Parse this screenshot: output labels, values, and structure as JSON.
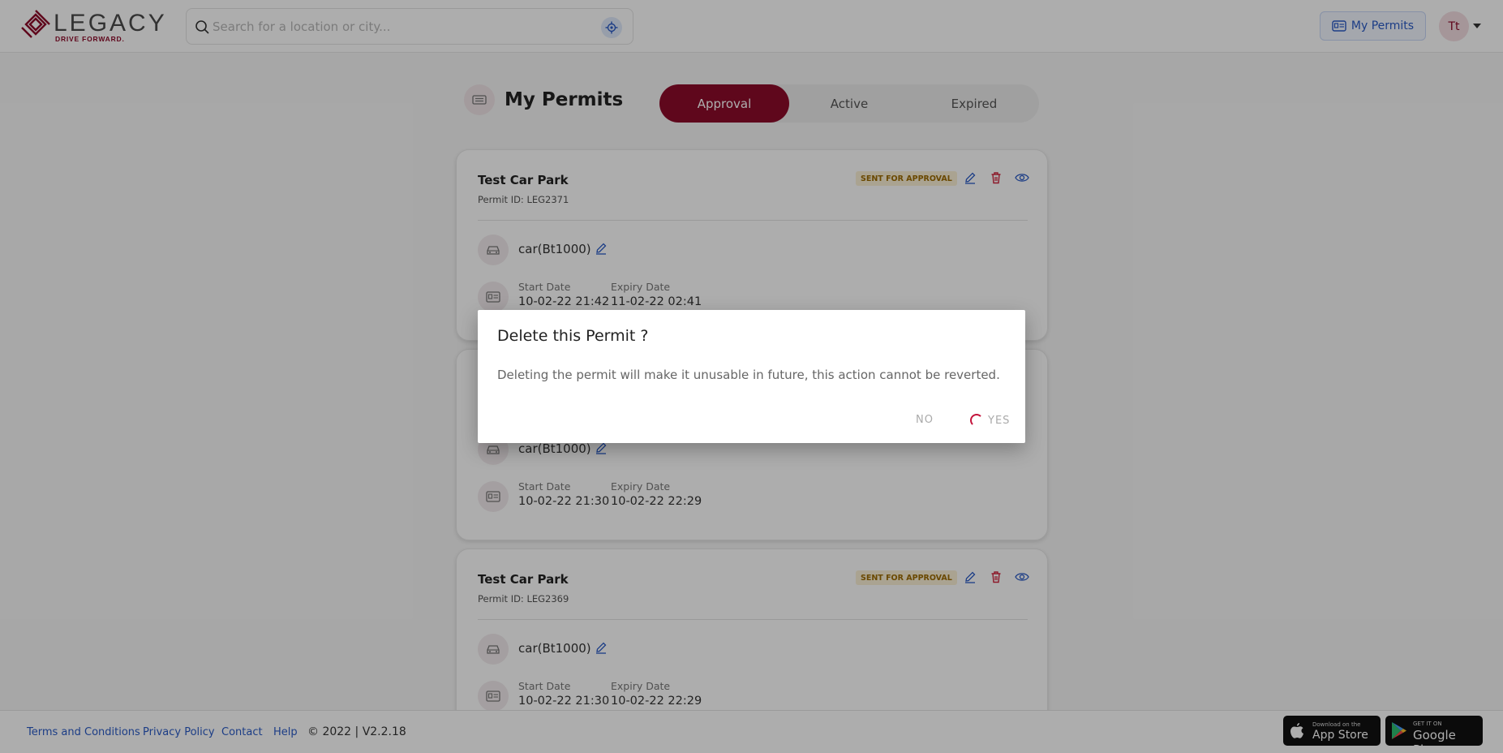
{
  "header": {
    "logo_text": "LEGACY",
    "logo_tagline": "DRIVE FORWARD.",
    "search_placeholder": "Search for a location or city...",
    "my_permits_label": "My Permits",
    "avatar_initials": "Tt"
  },
  "page": {
    "title": "My Permits",
    "tabs": [
      {
        "label": "Approval",
        "active": true
      },
      {
        "label": "Active",
        "active": false
      },
      {
        "label": "Expired",
        "active": false
      }
    ]
  },
  "permits": [
    {
      "name": "Test Car Park",
      "permit_id": "Permit ID: LEG2371",
      "status": "SENT FOR APPROVAL",
      "vehicle": "car(Bt1000)",
      "start_label": "Start Date",
      "start_value": "10-02-22 21:42",
      "expiry_label": "Expiry Date",
      "expiry_value": "11-02-22 02:41"
    },
    {
      "name": "",
      "permit_id": "",
      "status": "",
      "vehicle": "car(Bt1000)",
      "start_label": "Start Date",
      "start_value": "10-02-22 21:30",
      "expiry_label": "Expiry Date",
      "expiry_value": "10-02-22 22:29"
    },
    {
      "name": "Test Car Park",
      "permit_id": "Permit ID: LEG2369",
      "status": "SENT FOR APPROVAL",
      "vehicle": "car(Bt1000)",
      "start_label": "Start Date",
      "start_value": "10-02-22 21:30",
      "expiry_label": "Expiry Date",
      "expiry_value": "10-02-22 22:29"
    }
  ],
  "footer": {
    "links": [
      "Terms and Conditions",
      "Privacy Policy",
      "Contact",
      "Help"
    ],
    "copyright": "© 2022 | V2.2.18",
    "app_store_small": "Download on the",
    "app_store_big": "App Store",
    "google_play_small": "GET IT ON",
    "google_play_big": "Google Play"
  },
  "modal": {
    "title": "Delete this Permit ?",
    "message": "Deleting the permit will make it unusable in future, this action cannot be reverted.",
    "no_label": "NO",
    "yes_label": "YES"
  },
  "colors": {
    "brand": "#8d0b2a",
    "link": "#2a5bc6",
    "delete": "#d0263f",
    "badge_bg": "#fbf0d6",
    "badge_text": "#9c6b00"
  },
  "icons": [
    "search-icon",
    "locate-icon",
    "permit-card-icon",
    "user-caret-icon",
    "edit-icon",
    "delete-icon",
    "view-icon",
    "car-icon",
    "calendar-card-icon",
    "apple-icon",
    "google-play-icon"
  ]
}
